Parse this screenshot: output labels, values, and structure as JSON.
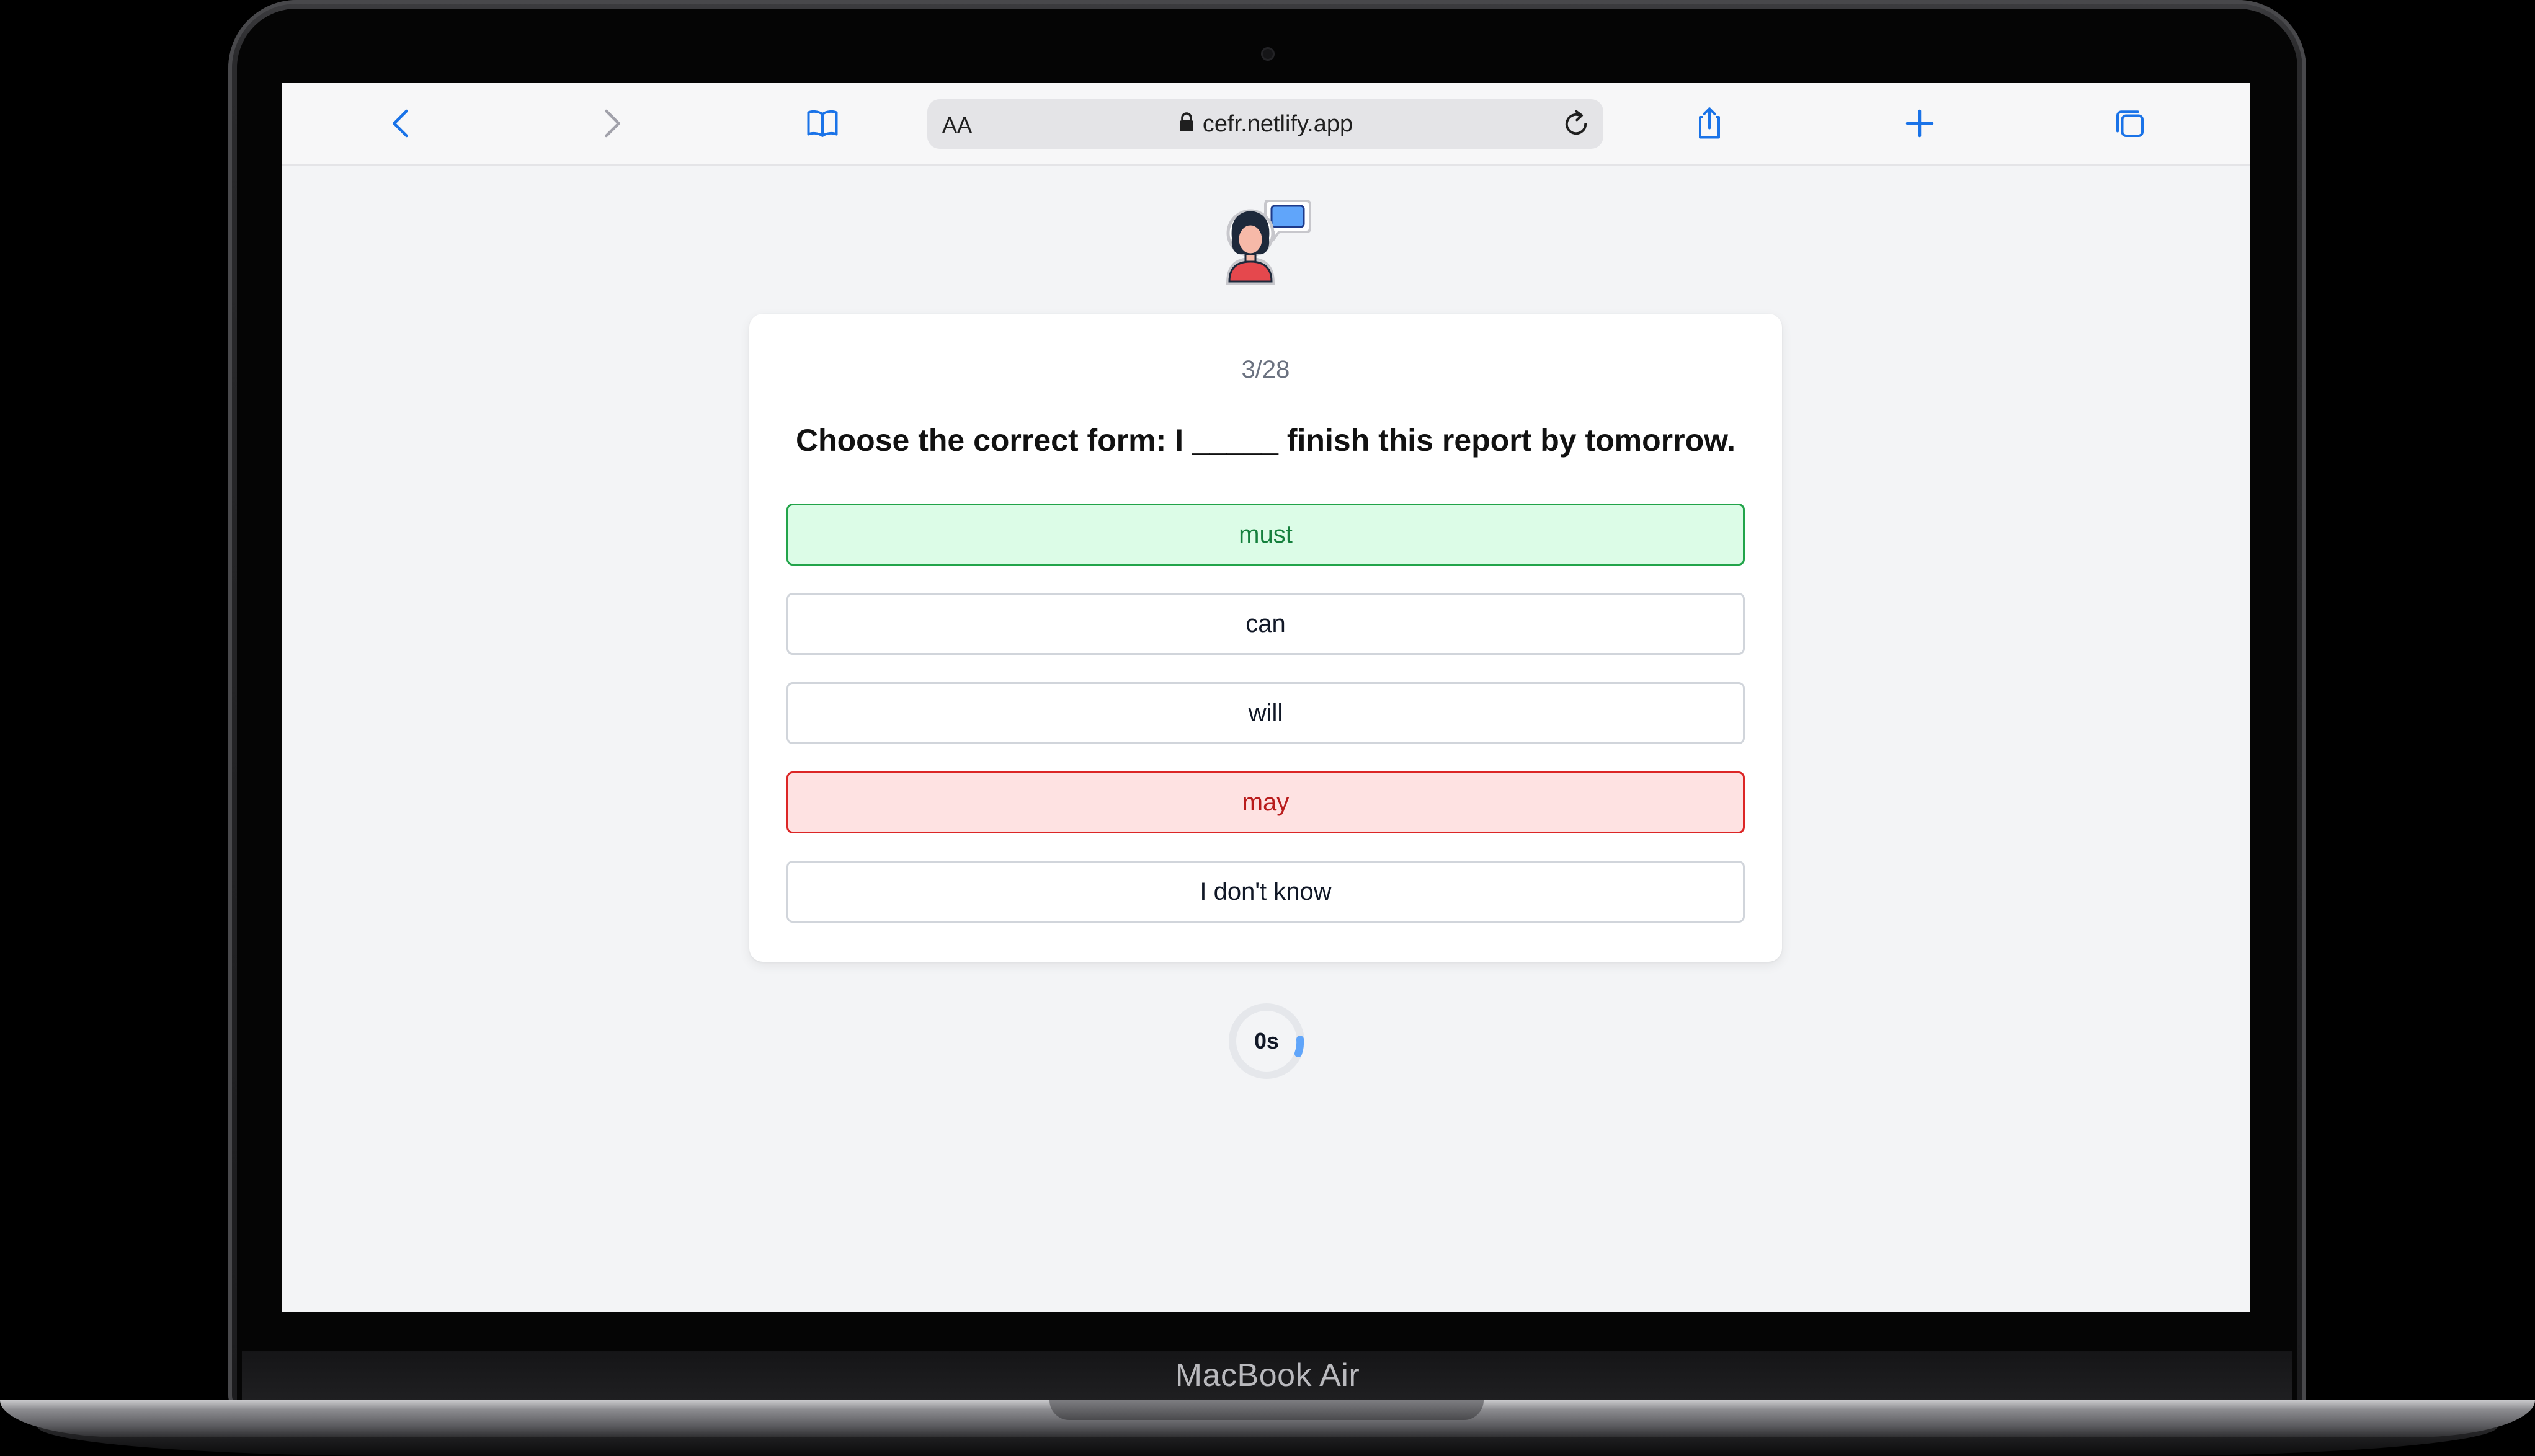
{
  "device": {
    "label": "MacBook Air"
  },
  "browser": {
    "text_size_label": "AA",
    "url": "cefr.netlify.app",
    "icons": [
      "back-icon",
      "forward-icon",
      "bookmarks-icon",
      "lock-icon",
      "reload-icon",
      "share-icon",
      "new-tab-icon",
      "tabs-icon"
    ]
  },
  "quiz": {
    "progress": "3/28",
    "question": "Choose the correct form: I _____ finish this report by tomorrow.",
    "options": [
      {
        "label": "must",
        "state": "correct"
      },
      {
        "label": "can",
        "state": "default"
      },
      {
        "label": "will",
        "state": "default"
      },
      {
        "label": "may",
        "state": "wrong"
      },
      {
        "label": "I don't know",
        "state": "default"
      }
    ],
    "timer": "0s"
  },
  "colors": {
    "accent": "#1a73e8",
    "correct_bg": "#dcfce7",
    "correct_border": "#22a44a",
    "wrong_bg": "#fee2e2",
    "wrong_border": "#dc2626",
    "timer_arc": "#60a5fa"
  }
}
